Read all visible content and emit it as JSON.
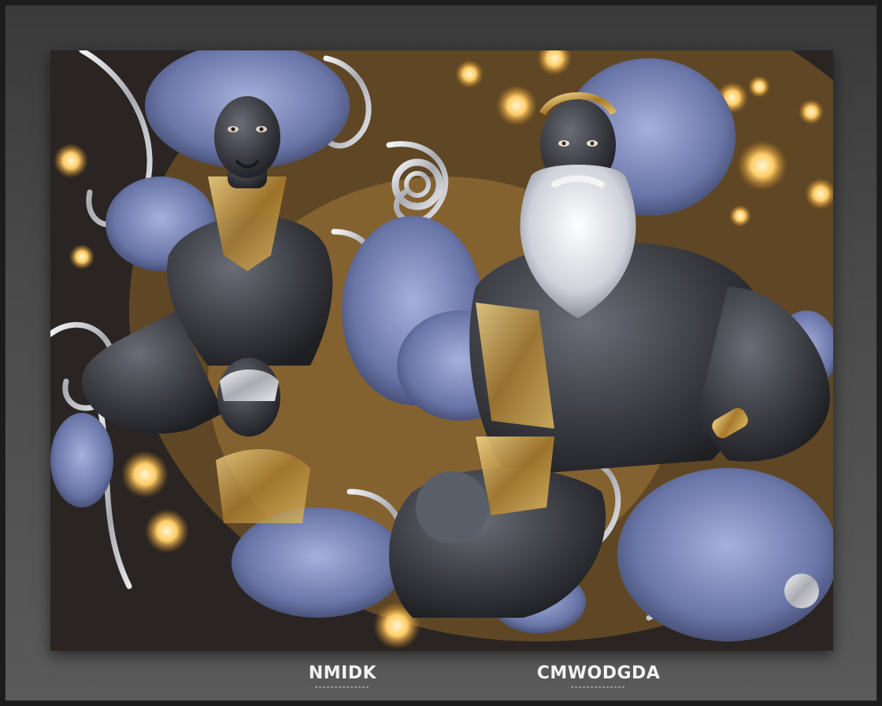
{
  "artwork": {
    "caption_left": "NMIDK",
    "caption_right": "CMWODGDA",
    "palette": {
      "skin": "#3a3c42",
      "hair": "#7b86b8",
      "silver": "#d8d8de",
      "gold": "#d9b05a",
      "glow": "#ffcc66"
    }
  }
}
